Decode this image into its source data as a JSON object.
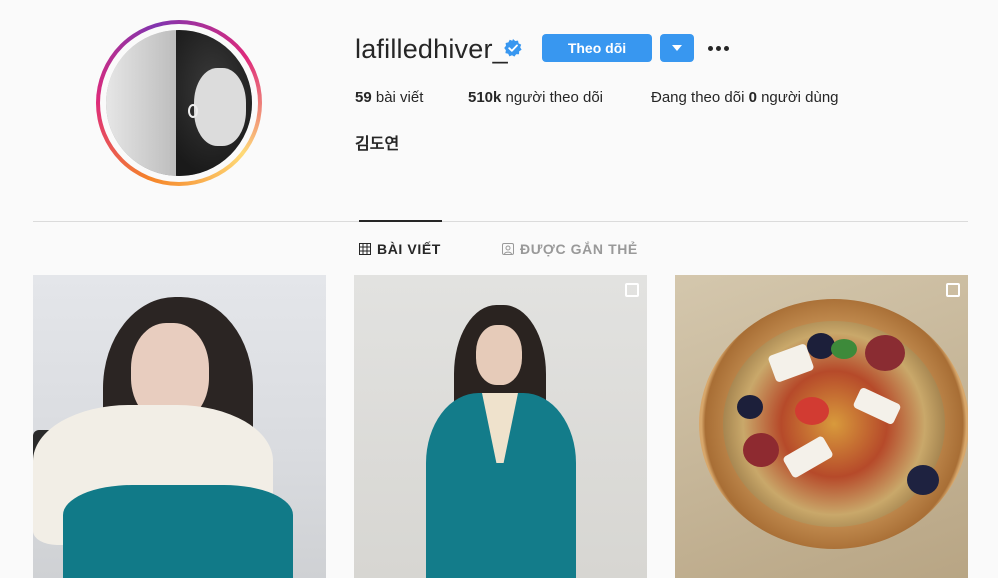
{
  "profile": {
    "username": "lafilledhiver_",
    "verified": true,
    "follow_label": "Theo dõi",
    "full_name": "김도연",
    "stats": {
      "posts_count": "59",
      "posts_label": "bài viết",
      "followers_count": "510k",
      "followers_label": "người theo dõi",
      "following_prefix": "Đang theo dõi",
      "following_count": "0",
      "following_suffix": "người dùng"
    }
  },
  "tabs": [
    {
      "label": "BÀI VIẾT",
      "icon": "grid-icon",
      "active": true
    },
    {
      "label": "ĐƯỢC GẮN THẺ",
      "icon": "tagged-icon",
      "active": false
    }
  ],
  "posts": [
    {
      "description": "woman-white-blouse-teal",
      "multi": false
    },
    {
      "description": "woman-teal-blazer",
      "multi": true
    },
    {
      "description": "fruit-bowl",
      "multi": true
    }
  ],
  "colors": {
    "accent": "#3897f0",
    "text": "#262626",
    "muted": "#999999",
    "background": "#fafafa",
    "divider": "#dbdbdb"
  }
}
